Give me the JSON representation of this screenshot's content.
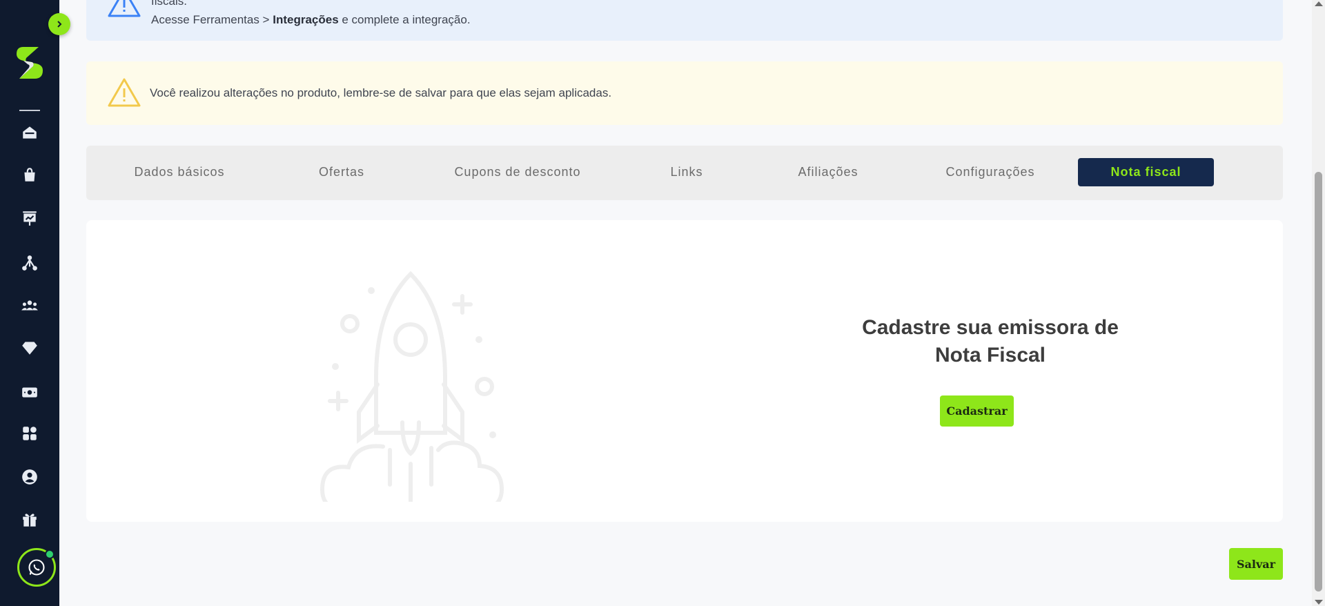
{
  "sidebar": {
    "logo": "brand-logo-s",
    "items": [
      {
        "name": "home-icon"
      },
      {
        "name": "shopping-bag-icon"
      },
      {
        "name": "presentation-chart-icon"
      },
      {
        "name": "affiliates-network-icon"
      },
      {
        "name": "users-group-icon"
      },
      {
        "name": "diamond-icon"
      },
      {
        "name": "money-icon"
      },
      {
        "name": "apps-grid-icon"
      },
      {
        "name": "user-circle-icon"
      },
      {
        "name": "gift-icon"
      }
    ],
    "whatsapp": "whatsapp-icon"
  },
  "alerts": {
    "info": {
      "line1": "fiscais.",
      "line2_prefix": "Acesse Ferramentas > ",
      "line2_bold": "Integrações",
      "line2_suffix": " e complete a integração."
    },
    "warning": {
      "text": "Você realizou alterações no produto, lembre-se de salvar para que elas sejam aplicadas."
    }
  },
  "tabs": [
    {
      "label": "Dados básicos",
      "active": false
    },
    {
      "label": "Ofertas",
      "active": false
    },
    {
      "label": "Cupons de desconto",
      "active": false
    },
    {
      "label": "Links",
      "active": false
    },
    {
      "label": "Afiliações",
      "active": false
    },
    {
      "label": "Configurações",
      "active": false
    },
    {
      "label": "Nota fiscal",
      "active": true
    }
  ],
  "main": {
    "title_line1": "Cadastre sua emissora de",
    "title_line2": "Nota Fiscal",
    "cta_label": "Cadastrar"
  },
  "footer": {
    "save_label": "Salvar"
  },
  "colors": {
    "sidebar_bg": "#0f1a2e",
    "accent_green": "#8ee61a",
    "active_tab_bg": "#15294d",
    "info_bg": "#e8f0fb",
    "warning_bg": "#fefbea",
    "warning_icon": "#f2c94c",
    "info_icon": "#3b82f6"
  }
}
